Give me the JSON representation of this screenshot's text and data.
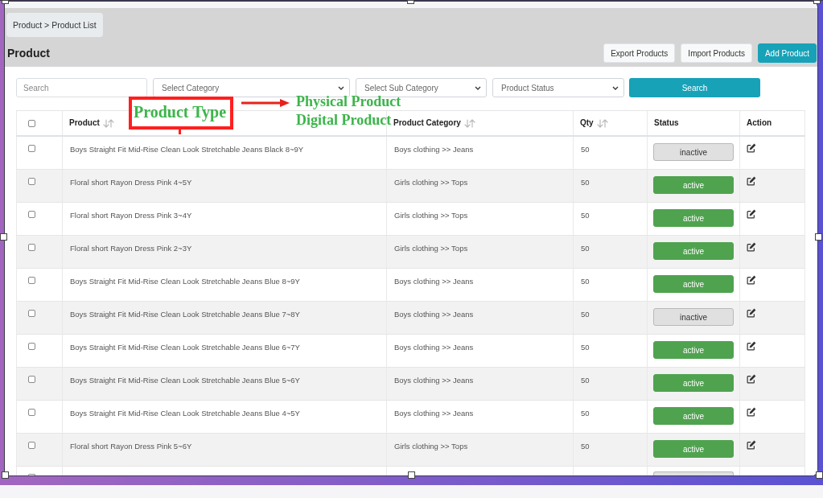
{
  "breadcrumb": "Product > Product List",
  "page_title": "Product",
  "actions": [
    {
      "label": "Export Products",
      "kind": "light"
    },
    {
      "label": "Import Products",
      "kind": "light"
    },
    {
      "label": "Add Product",
      "kind": "primary"
    }
  ],
  "filters": {
    "search": {
      "placeholder": "Search"
    },
    "selects": [
      {
        "placeholder": "Select Category"
      },
      {
        "placeholder": "Select Sub Category"
      },
      {
        "placeholder": "Product Status"
      }
    ],
    "button": "Search"
  },
  "table": {
    "select_all": {
      "checked": false
    },
    "columns": [
      {
        "label": "Product",
        "sortable": true
      },
      {
        "label": "Product Category",
        "sortable": true
      },
      {
        "label": "Qty",
        "sortable": true
      },
      {
        "label": "Status",
        "sortable": false
      },
      {
        "label": "Action",
        "sortable": false
      }
    ],
    "rows": [
      {
        "checked": false,
        "product": "Boys Straight Fit Mid-Rise Clean Look Stretchable Jeans Black 8~9Y",
        "category": "Boys clothing >> Jeans",
        "qty": "50",
        "status": "inactive",
        "active": false
      },
      {
        "checked": false,
        "product": "Floral short Rayon Dress Pink 4~5Y",
        "category": "Girls clothing >> Tops",
        "qty": "50",
        "status": "active",
        "active": true
      },
      {
        "checked": false,
        "product": "Floral short Rayon Dress Pink 3~4Y",
        "category": "Girls clothing >> Tops",
        "qty": "50",
        "status": "active",
        "active": true
      },
      {
        "checked": false,
        "product": "Floral short Rayon Dress Pink 2~3Y",
        "category": "Girls clothing >> Tops",
        "qty": "50",
        "status": "active",
        "active": true
      },
      {
        "checked": false,
        "product": "Boys Straight Fit Mid-Rise Clean Look Stretchable Jeans Blue 8~9Y",
        "category": "Boys clothing >> Jeans",
        "qty": "50",
        "status": "active",
        "active": true
      },
      {
        "checked": false,
        "product": "Boys Straight Fit Mid-Rise Clean Look Stretchable Jeans Blue 7~8Y",
        "category": "Boys clothing >> Jeans",
        "qty": "50",
        "status": "inactive",
        "active": false
      },
      {
        "checked": false,
        "product": "Boys Straight Fit Mid-Rise Clean Look Stretchable Jeans Blue 6~7Y",
        "category": "Boys clothing >> Jeans",
        "qty": "50",
        "status": "active",
        "active": true
      },
      {
        "checked": false,
        "product": "Boys Straight Fit Mid-Rise Clean Look Stretchable Jeans Blue 5~6Y",
        "category": "Boys clothing >> Jeans",
        "qty": "50",
        "status": "active",
        "active": true
      },
      {
        "checked": false,
        "product": "Boys Straight Fit Mid-Rise Clean Look Stretchable Jeans Blue 4~5Y",
        "category": "Boys clothing >> Jeans",
        "qty": "50",
        "status": "active",
        "active": true
      },
      {
        "checked": false,
        "product": "Floral short Rayon Dress Pink 5~6Y",
        "category": "Girls clothing >> Tops",
        "qty": "50",
        "status": "active",
        "active": true
      }
    ],
    "partial_row": {
      "checked": false,
      "active": false
    }
  },
  "annotation": {
    "label": "Product Type",
    "options": [
      "Physical Product",
      "Digital Product"
    ]
  }
}
